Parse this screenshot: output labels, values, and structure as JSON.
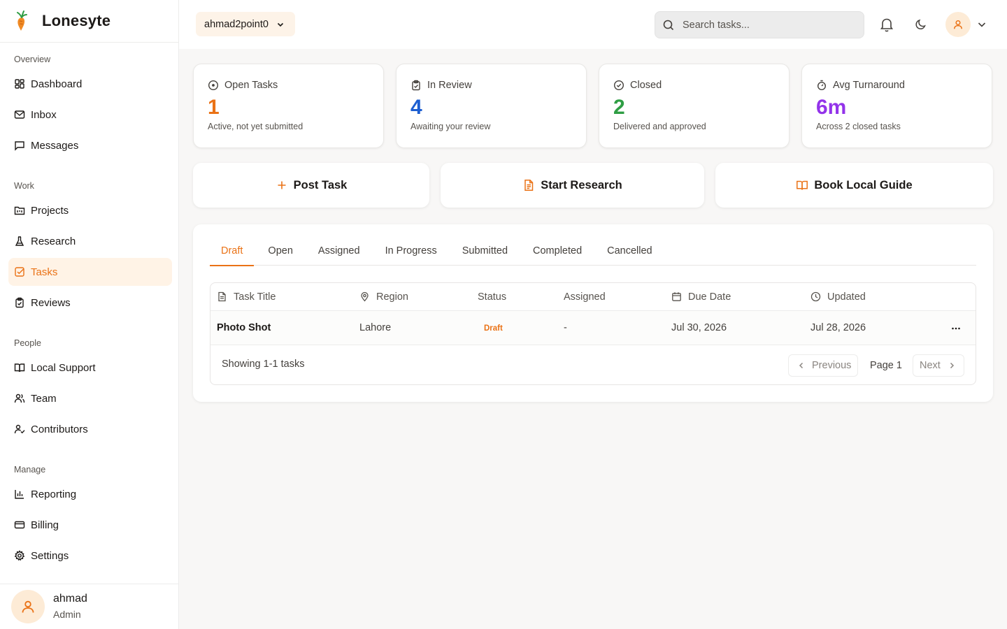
{
  "brand": {
    "name": "Lonesyte"
  },
  "sidebar": {
    "sections": [
      {
        "title": "Overview",
        "items": [
          {
            "label": "Dashboard"
          },
          {
            "label": "Inbox"
          },
          {
            "label": "Messages"
          }
        ]
      },
      {
        "title": "Work",
        "items": [
          {
            "label": "Projects"
          },
          {
            "label": "Research"
          },
          {
            "label": "Tasks"
          },
          {
            "label": "Reviews"
          }
        ]
      },
      {
        "title": "People",
        "items": [
          {
            "label": "Local Support"
          },
          {
            "label": "Team"
          },
          {
            "label": "Contributors"
          }
        ]
      },
      {
        "title": "Manage",
        "items": [
          {
            "label": "Reporting"
          },
          {
            "label": "Billing"
          },
          {
            "label": "Settings"
          }
        ]
      }
    ],
    "active_item": "Tasks",
    "user": {
      "name": "ahmad",
      "role": "Admin"
    }
  },
  "topbar": {
    "workspace": "ahmad2point0",
    "search_placeholder": "Search tasks...",
    "icons": [
      "bell-icon",
      "moon-icon",
      "user-icon",
      "chevron-down-icon"
    ]
  },
  "stats": [
    {
      "label": "Open Tasks",
      "value": "1",
      "sub": "Active, not yet submitted",
      "color": "#ea7216",
      "icon": "circle-dot-icon"
    },
    {
      "label": "In Review",
      "value": "4",
      "sub": "Awaiting your review",
      "color": "#1d5fd1",
      "icon": "clipboard-icon"
    },
    {
      "label": "Closed",
      "value": "2",
      "sub": "Delivered and approved",
      "color": "#2f9e44",
      "icon": "check-circle-icon"
    },
    {
      "label": "Avg Turnaround",
      "value": "6m",
      "sub": "Across 2 closed tasks",
      "color": "#9333ea",
      "icon": "timer-icon"
    }
  ],
  "actions": [
    {
      "label": "Post Task",
      "icon": "plus-icon"
    },
    {
      "label": "Start Research",
      "icon": "file-text-icon"
    },
    {
      "label": "Book Local Guide",
      "icon": "book-open-icon"
    }
  ],
  "tabs": [
    "Draft",
    "Open",
    "Assigned",
    "In Progress",
    "Submitted",
    "Completed",
    "Cancelled"
  ],
  "active_tab": "Draft",
  "table": {
    "columns": [
      "Task Title",
      "Region",
      "Status",
      "Assigned",
      "Due Date",
      "Updated"
    ],
    "rows": [
      {
        "title": "Photo Shot",
        "region": "Lahore",
        "status": "Draft",
        "assigned": "-",
        "due": "Jul 30, 2026",
        "updated": "Jul 28, 2026"
      }
    ],
    "showing": "Showing 1-1 tasks",
    "pagination": {
      "previous": "Previous",
      "page": "Page 1",
      "next": "Next"
    }
  },
  "colors": {
    "accent": "#ea7216",
    "accent_soft": "#fff3e6"
  }
}
